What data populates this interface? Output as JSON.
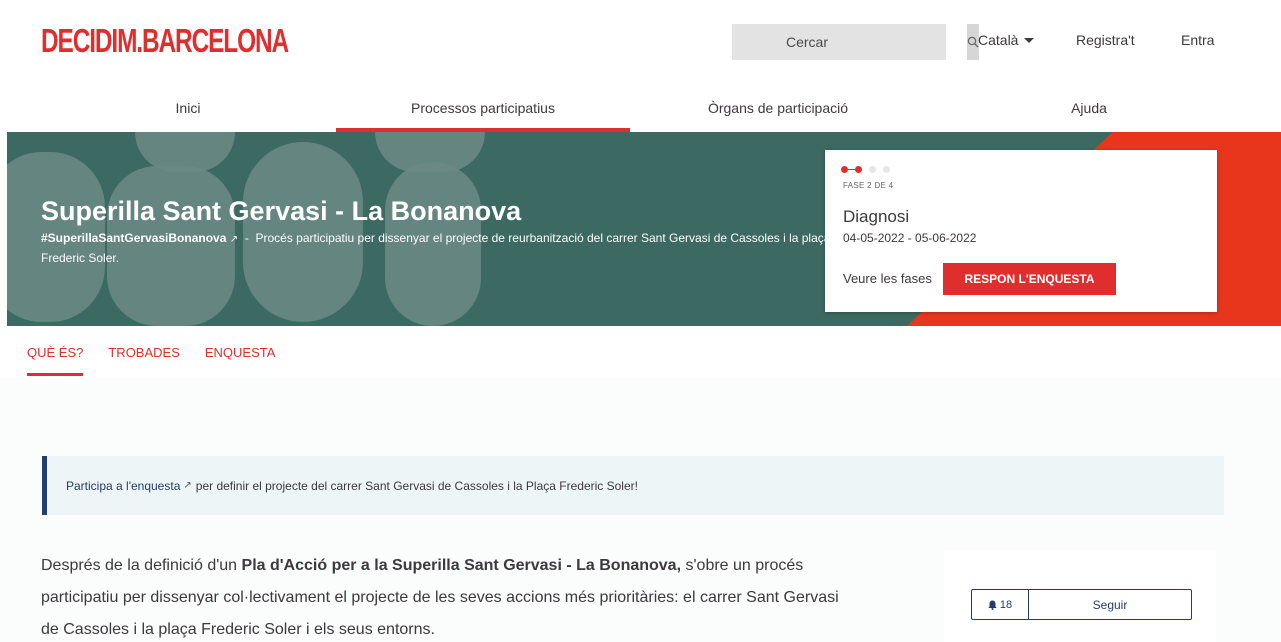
{
  "header": {
    "logo": "DECIDIM.BARCELONA",
    "search_placeholder": "Cercar",
    "language": "Català",
    "register": "Registra't",
    "login": "Entra"
  },
  "nav": {
    "items": [
      {
        "label": "Inici"
      },
      {
        "label": "Processos participatius"
      },
      {
        "label": "Òrgans de participació"
      },
      {
        "label": "Ajuda"
      }
    ],
    "active_index": 1
  },
  "hero": {
    "title": "Superilla Sant Gervasi - La Bonanova",
    "hashtag": "#SuperillaSantGervasiBonanova",
    "separator": "-",
    "description": "Procés participatiu per dissenyar el projecte de reurbanització del carrer Sant Gervasi de Cassoles i la plaça Frederic Soler.",
    "phase": {
      "count": "FASE 2 DE 4",
      "name": "Diagnosi",
      "dates": "04-05-2022 - 05-06-2022",
      "see_phases": "Veure les fases",
      "cta": "RESPON L'ENQUESTA",
      "current": 2,
      "total": 4
    }
  },
  "subtabs": [
    {
      "label": "QUÈ ÉS?"
    },
    {
      "label": "TROBADES"
    },
    {
      "label": "ENQUESTA"
    }
  ],
  "callout": {
    "link": "Participa a l'enquesta",
    "text": "per definir el projecte del carrer Sant Gervasi de Cassoles i la Plaça Frederic Soler!"
  },
  "body": {
    "intro": "Després de la definició d'un",
    "bold": "Pla d'Acció per a la Superilla Sant Gervasi - La Bonanova,",
    "rest": "s'obre un procés participatiu per dissenyar col·lectivament el projecte de les seves accions més prioritàries: el carrer Sant Gervasi de Cassoles i la plaça Frederic Soler i els seus entorns."
  },
  "follow": {
    "count": "18",
    "label": "Seguir"
  },
  "colors": {
    "brand_red": "#e02d2d",
    "hero_green": "#3c6a63",
    "navy": "#233d6c"
  }
}
